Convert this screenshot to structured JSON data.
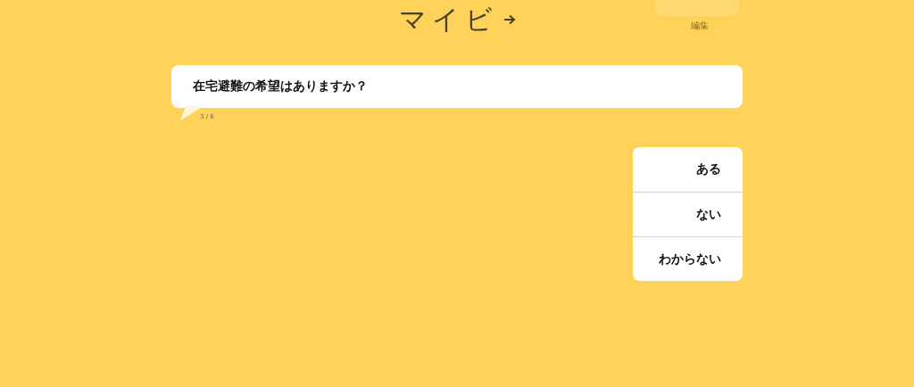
{
  "header": {
    "logo": "マイビ",
    "edit_label": "編集"
  },
  "question": {
    "text": "在宅避難の希望はありますか？",
    "progress": "3 / 6"
  },
  "options": [
    {
      "label": "ある"
    },
    {
      "label": "ない"
    },
    {
      "label": "わからない"
    }
  ]
}
